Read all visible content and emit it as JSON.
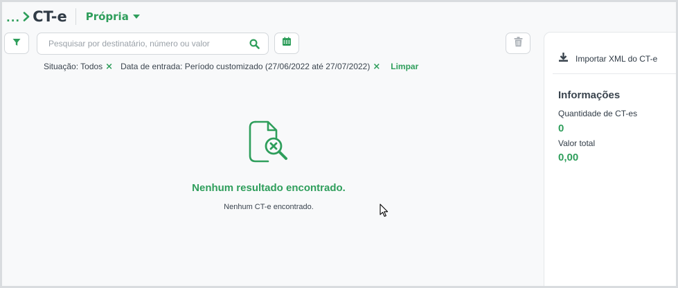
{
  "header": {
    "breadcrumb_ellipsis": "...",
    "title": "CT-e",
    "dropdown_label": "Própria"
  },
  "toolbar": {
    "search_placeholder": "Pesquisar por destinatário, número ou valor",
    "search_value": ""
  },
  "filters": [
    {
      "text": "Situação: Todos"
    },
    {
      "text": "Data de entrada: Período customizado (27/06/2022 até 27/07/2022)"
    }
  ],
  "filters_clear_label": "Limpar",
  "empty_state": {
    "title": "Nenhum resultado encontrado.",
    "subtitle": "Nenhum CT-e encontrado."
  },
  "side_panel": {
    "import_label": "Importar XML do CT-e",
    "info_title": "Informações",
    "quantity_label": "Quantidade de CT-es",
    "quantity_value": "0",
    "total_label": "Valor total",
    "total_value": "0,00"
  },
  "colors": {
    "accent": "#2e9e5b",
    "text": "#2f3a45",
    "background": "#f8f9fa",
    "border": "#d3d7db"
  },
  "icons": [
    "chevron-right-icon",
    "caret-down-icon",
    "filter-icon",
    "search-icon",
    "calendar-icon",
    "trash-icon",
    "close-icon",
    "download-icon",
    "document-search-x-icon",
    "mouse-cursor-icon"
  ]
}
